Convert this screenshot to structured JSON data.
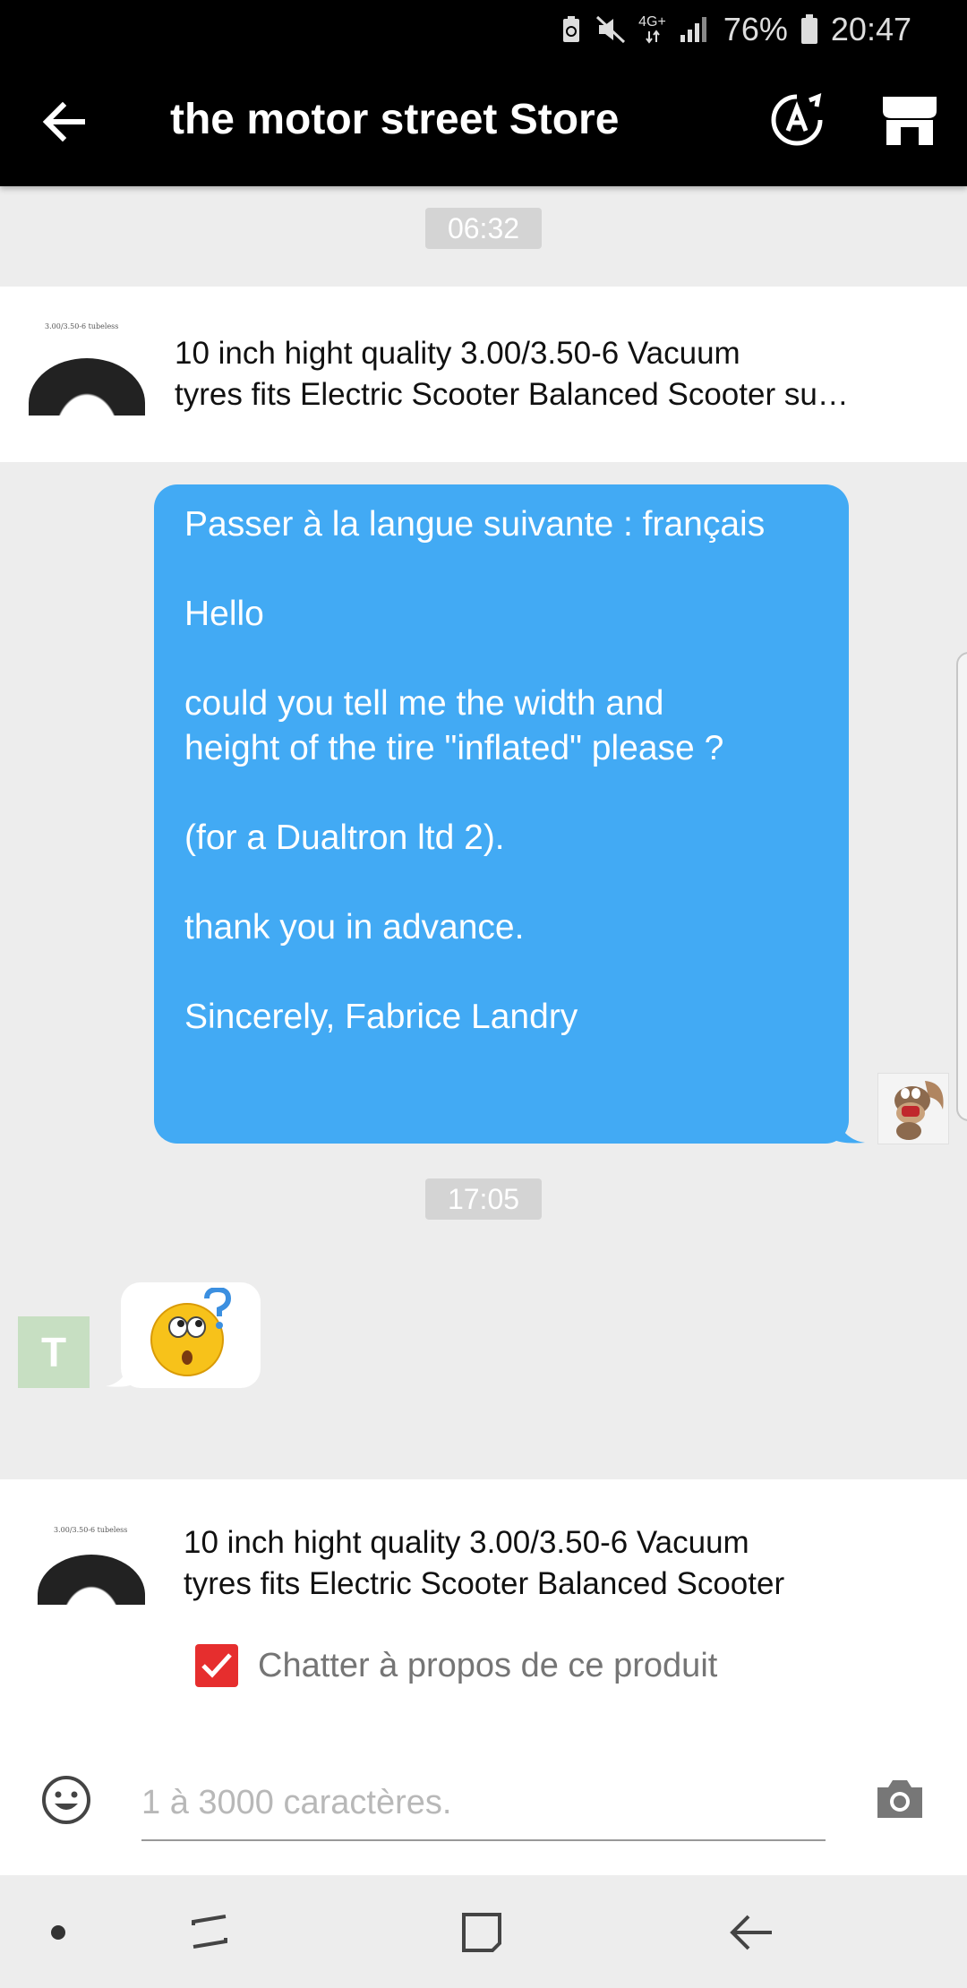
{
  "status_bar": {
    "battery": "76%",
    "time": "20:47",
    "network": "4G+",
    "icons": [
      "battery-saver-icon",
      "mute-icon",
      "network-4g-icon",
      "signal-icon",
      "battery-icon"
    ]
  },
  "header": {
    "title": "the motor street Store",
    "icons": [
      "back-arrow-icon",
      "translate-icon",
      "store-icon"
    ]
  },
  "messages": {
    "time_1": "06:32",
    "product_1": {
      "thumb_label": "3.00/3.50-6 tubeless",
      "title_line_1": "10 inch hight quality 3.00/3.50-6 Vacuum",
      "title_line_2": "tyres fits Electric Scooter Balanced Scooter su…"
    },
    "outgoing": {
      "line_1": "Passer à la langue suivante : français",
      "line_2": "Hello",
      "line_3a": "could you tell me the width and",
      "line_3b": "height of the tire \"inflated\" please ?",
      "line_4": "(for a Dualtron ltd 2).",
      "line_5": "thank you in advance.",
      "line_6": "Sincerely, Fabrice Landry"
    },
    "time_2": "17:05",
    "incoming": {
      "avatar_letter": "T",
      "emoji": "confused-face-question-mark"
    }
  },
  "composer": {
    "product": {
      "thumb_label": "3.00/3.50-6 tubeless",
      "title_line_1": "10 inch hight quality 3.00/3.50-6 Vacuum",
      "title_line_2": "tyres fits Electric Scooter Balanced Scooter"
    },
    "chat_about_label": "Chatter à propos de ce produit",
    "chat_about_checked": true,
    "input_placeholder": "1 à 3000 caractères.",
    "icons": [
      "emoji-icon",
      "camera-icon"
    ]
  },
  "nav_bar": {
    "icons": [
      "nav-dot-icon",
      "recents-icon",
      "home-icon",
      "back-icon"
    ]
  },
  "colors": {
    "outgoing_bubble": "#42aaf4",
    "checkbox": "#e62e2e",
    "appbar": "#000000",
    "background": "#ededed"
  }
}
